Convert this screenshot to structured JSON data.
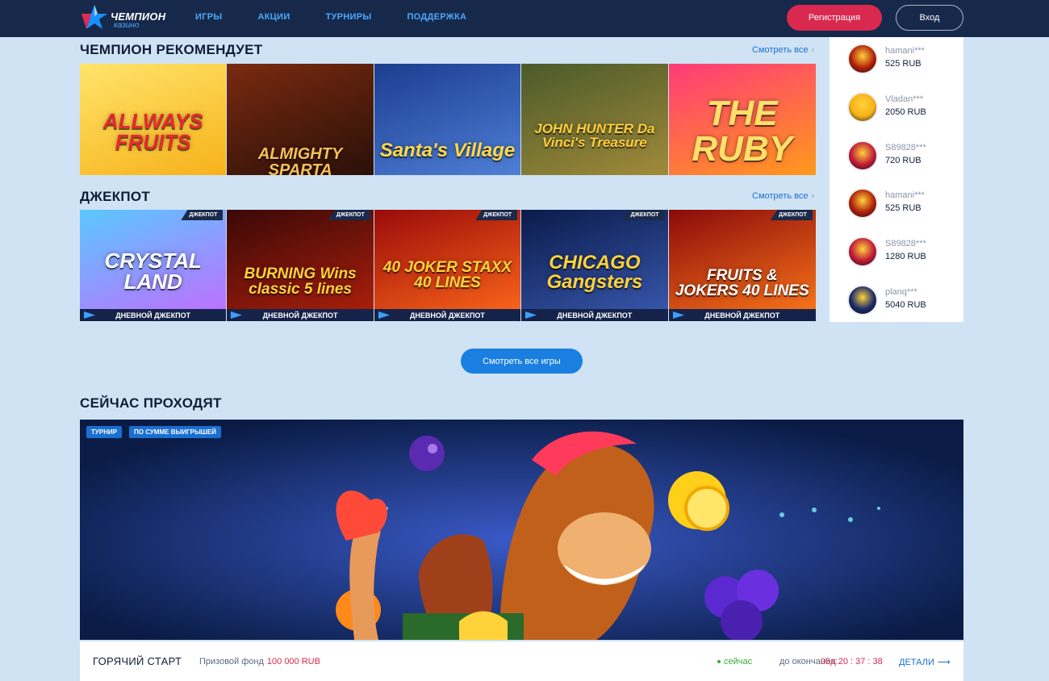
{
  "header": {
    "logo_title": "ЧЕМПИОН",
    "logo_sub": "казино",
    "nav": [
      "ИГРЫ",
      "АКЦИИ",
      "ТУРНИРЫ",
      "ПОДДЕРЖКА"
    ],
    "register": "Регистрация",
    "login": "Вход"
  },
  "recommends": {
    "title": "ЧЕМПИОН РЕКОМЕНДУЕТ",
    "see_all": "Смотреть все",
    "games": [
      {
        "title": "ALLWAYS FRUITS",
        "colors": [
          "#ffe46b",
          "#f7b21a"
        ],
        "text_color": "#e62a2a"
      },
      {
        "title": "ALMIGHTY SPARTA",
        "colors": [
          "#7a2a10",
          "#2a1008"
        ],
        "text_color": "#f5c15a"
      },
      {
        "title": "Santa's Village",
        "colors": [
          "#1b3d8f",
          "#4f7fd6"
        ],
        "text_color": "#ffd84a"
      },
      {
        "title": "JOHN HUNTER Da Vinci's Treasure",
        "colors": [
          "#4b5a2a",
          "#a08a3a"
        ],
        "text_color": "#ffce3a"
      },
      {
        "title": "THE RUBY",
        "colors": [
          "#ff3a7a",
          "#ff9a1a"
        ],
        "text_color": "#ffe06a"
      }
    ]
  },
  "jackpot": {
    "title": "ДЖЕКПОТ",
    "see_all": "Смотреть все",
    "badge": "ДЖЕКПОТ",
    "strip": "ДНЕВНОЙ ДЖЕКПОТ",
    "games": [
      {
        "title": "CRYSTAL LAND",
        "colors": [
          "#5ac8ff",
          "#c46aff"
        ],
        "text_color": "#ffffff"
      },
      {
        "title": "BURNING Wins classic 5 lines",
        "colors": [
          "#3a0808",
          "#b0200a"
        ],
        "text_color": "#ffd23a"
      },
      {
        "title": "40 JOKER STAXX 40 LINES",
        "colors": [
          "#9a0a0a",
          "#ff6a1a"
        ],
        "text_color": "#ffd23a"
      },
      {
        "title": "CHICAGO Gangsters",
        "colors": [
          "#0a1a4a",
          "#3a5ab0"
        ],
        "text_color": "#ffd23a"
      },
      {
        "title": "FRUITS & JOKERS 40 LINES",
        "colors": [
          "#8a0a0a",
          "#ff7a1a"
        ],
        "text_color": "#ffffff"
      }
    ]
  },
  "winners": [
    {
      "name": "hamani***",
      "amount": "525 RUB",
      "color": "#b0200a"
    },
    {
      "name": "Vladan***",
      "amount": "2050 RUB",
      "color": "#f7b21a"
    },
    {
      "name": "S89828***",
      "amount": "720 RUB",
      "color": "#c01a3a"
    },
    {
      "name": "hamani***",
      "amount": "525 RUB",
      "color": "#b0200a"
    },
    {
      "name": "S89828***",
      "amount": "1280 RUB",
      "color": "#c01a3a"
    },
    {
      "name": "planq***",
      "amount": "5040 RUB",
      "color": "#1a2a6a"
    }
  ],
  "view_all_games": "Смотреть все игры",
  "tournament": {
    "section_title": "СЕЙЧАС ПРОХОДЯТ",
    "tag1": "ТУРНИР",
    "tag2": "ПО СУММЕ ВЫИГРЫШЕЙ",
    "name": "ГОРЯЧИЙ СТАРТ",
    "prize_label": "Призовой фонд",
    "prize_value": "100 000 RUB",
    "status": "сейчас",
    "ends_label": "до окончания:",
    "timer": "05д  20 : 37 : 38",
    "details": "ДЕТАЛИ"
  }
}
